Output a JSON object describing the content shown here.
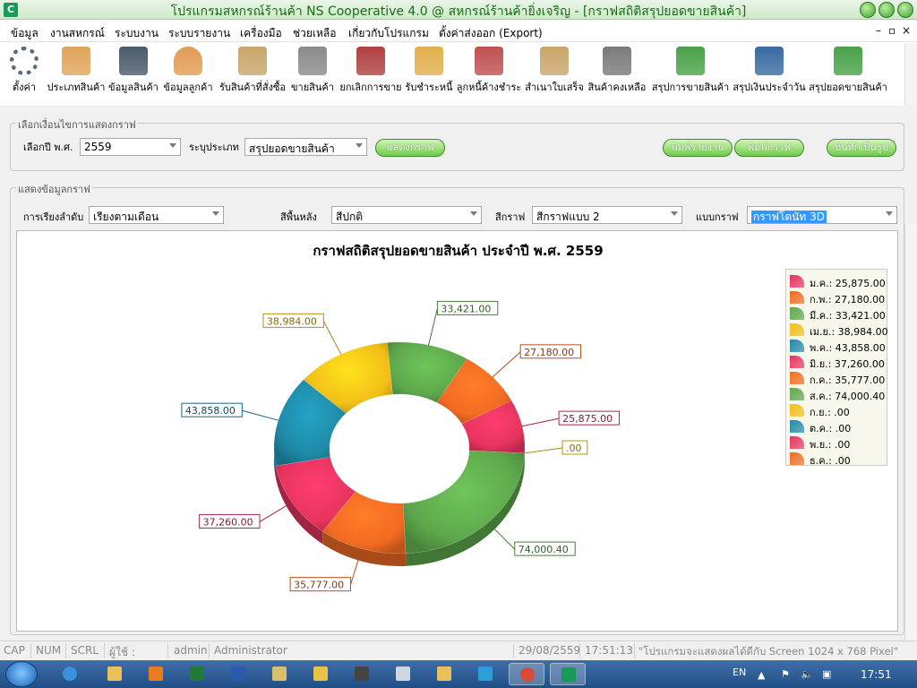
{
  "window": {
    "icon_letter": "C",
    "title": "โปรแกรมสหกรณ์ร้านค้า NS Cooperative 4.0 @ สหกรณ์ร้านค้ายิ่งเจริญ - [กราฟสถิติสรุปยอดขายสินค้า]"
  },
  "menu": [
    "ข้อมูล",
    "งานสหกรณ์",
    "ระบบงาน",
    "ระบบรายงาน",
    "เครื่องมือ",
    "ช่วยเหลือ",
    "เกี่ยวกับโปรแกรม",
    "ตั้งค่าส่งออก (Export)"
  ],
  "mdi_controls": [
    "–",
    "▫",
    "×"
  ],
  "toolbar": [
    {
      "label": "ตั้งค่า",
      "icon": "gear-icon",
      "color": "#5b6b7a"
    },
    {
      "label": "ประเภทสินค้า",
      "icon": "folder-icon",
      "color": "#e0a55a"
    },
    {
      "label": "ข้อมูลสินค้า",
      "icon": "barcode-icon",
      "color": "#4a5a6a"
    },
    {
      "label": "ข้อมูลลูกค้า",
      "icon": "customer-icon",
      "color": "#e39b55"
    },
    {
      "label": "รับสินค้าที่สั่งซื้อ",
      "icon": "clipboard-icon",
      "color": "#c9a56a"
    },
    {
      "label": "ขายสินค้า",
      "icon": "cart-icon",
      "color": "#8a8a8a"
    },
    {
      "label": "ยกเลิกการขาย",
      "icon": "cart-cancel-icon",
      "color": "#b04040"
    },
    {
      "label": "รับชำระหนี้",
      "icon": "payment-icon",
      "color": "#e2b04e"
    },
    {
      "label": "ลูกหนี้ค้างชำระ",
      "icon": "invoice-icon",
      "color": "#c05050"
    },
    {
      "label": "สำเนาใบเสร็จ",
      "icon": "receipt-icon",
      "color": "#c9a56a"
    },
    {
      "label": "สินค้าคงเหลือ",
      "icon": "inventory-icon",
      "color": "#7a7a7a"
    },
    {
      "label": "สรุปการขายสินค้า",
      "icon": "report-icon",
      "color": "#4aa14a"
    },
    {
      "label": "สรุปเงินประจำวัน",
      "icon": "calendar-clock-icon",
      "color": "#3a6aa0"
    },
    {
      "label": "สรุปยอดขายสินค้า",
      "icon": "bar-chart-icon",
      "color": "#4aa14a"
    }
  ],
  "options_group": {
    "title": "เลือกเงื่อนไขการแสดงกราฟ",
    "year_label": "เลือกปี พ.ศ.",
    "year_value": "2559",
    "type_label": "ระบุประเภท",
    "type_value": "สรุปยอดขายสินค้า",
    "show_button": "แสดงกราฟ",
    "print_report_button": "พิมพ์รายงาน",
    "print_chart_button": "พิมพ์กราฟ",
    "save_image_button": "บันทึกเป็นรูป"
  },
  "display_group": {
    "title": "แสดงข้อมูลกราฟ",
    "sort_label": "การเรียงลำดับ",
    "sort_value": "เรียงตามเดือน",
    "bg_label": "สีพื้นหลัง",
    "bg_value": "สีปกติ",
    "color_label": "สีกราฟ",
    "color_value": "สีกราฟแบบ 2",
    "style_label": "แบบกราฟ",
    "style_value": "กราฟโดนัท 3D"
  },
  "chart_data": {
    "type": "pie",
    "variant": "donut-3d",
    "title": "กราฟสถิติสรุปยอดขายสินค้า ประจำปี พ.ศ. 2559",
    "categories": [
      "ม.ค.",
      "ก.พ.",
      "มี.ค.",
      "เม.ย.",
      "พ.ค.",
      "มิ.ย.",
      "ก.ค.",
      "ส.ค.",
      "ก.ย.",
      "ต.ค.",
      "พ.ย.",
      "ธ.ค."
    ],
    "values": [
      25875.0,
      27180.0,
      33421.0,
      38984.0,
      43858.0,
      37260.0,
      35777.0,
      74000.4,
      0,
      0,
      0,
      0
    ],
    "value_labels": [
      "25,875.00",
      "27,180.00",
      "33,421.00",
      "38,984.00",
      "43,858.00",
      "37,260.00",
      "35,777.00",
      "74,000.40",
      ".00",
      ".00",
      ".00",
      ".00"
    ],
    "legend_labels": [
      "ม.ค.: 25,875.00",
      "ก.พ.: 27,180.00",
      "มี.ค.: 33,421.00",
      "เม.ย.: 38,984.00",
      "พ.ค.: 43,858.00",
      "มิ.ย.: 37,260.00",
      "ก.ค.: 35,777.00",
      "ส.ค.: 74,000.40",
      "ก.ย.: .00",
      "ต.ค.: .00",
      "พ.ย.: .00",
      "ธ.ค.: .00"
    ],
    "colors": [
      "#e8345f",
      "#f26b22",
      "#5ea84c",
      "#f2c018",
      "#1f8aa8",
      "#e8345f",
      "#f26b22",
      "#5ea84c",
      "#f2c018",
      "#1f8aa8",
      "#e8345f",
      "#f26b22"
    ],
    "legend_position": "right"
  },
  "statusbar": {
    "cap": "CAP",
    "num": "NUM",
    "scrl": "SCRL",
    "user_label": "ผู้ใช้  :",
    "user_id": "admin",
    "user_name": "Administrator",
    "date": "29/08/2559",
    "time": "17:51:13",
    "message": "\"โปรแกรมจะแสดงผลได้ดีกับ  Screen 1024 x 768 Pixel\""
  },
  "taskbar": {
    "apps": [
      {
        "icon": "ie-icon",
        "color": "#3a8fe0"
      },
      {
        "icon": "explorer-icon",
        "color": "#e9c15a"
      },
      {
        "icon": "media-player-icon",
        "color": "#e77b1e"
      },
      {
        "icon": "excel-icon",
        "color": "#1f7a3a"
      },
      {
        "icon": "word-icon",
        "color": "#2a5aa8"
      },
      {
        "icon": "paint-icon",
        "color": "#d8c06a"
      },
      {
        "icon": "key-icon",
        "color": "#e9c24a"
      },
      {
        "icon": "camera-icon",
        "color": "#444444"
      },
      {
        "icon": "notepad-icon",
        "color": "#cfd8e0"
      },
      {
        "icon": "folder-icon",
        "color": "#e9c15a"
      },
      {
        "icon": "network-icon",
        "color": "#2a9fd6"
      },
      {
        "icon": "chrome-icon",
        "color": "#d94a3a"
      },
      {
        "icon": "cooperative-app-icon",
        "color": "#1a9a5a"
      }
    ],
    "lang": "EN",
    "clock": "17:51"
  }
}
